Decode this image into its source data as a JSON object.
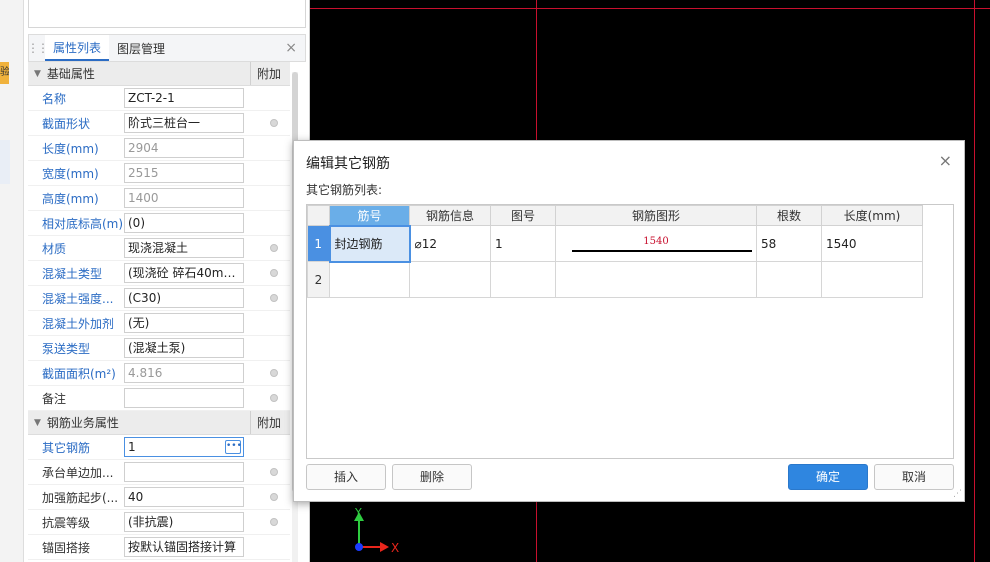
{
  "left_edge": {
    "tab_glyph": "验"
  },
  "panel": {
    "tabs": [
      {
        "label": "属性列表",
        "active": true
      },
      {
        "label": "图层管理",
        "active": false
      }
    ],
    "close_glyph": "×",
    "groups": [
      {
        "title": "基础属性",
        "extra_header": "附加",
        "rows": [
          {
            "label": "名称",
            "value": "ZCT-2-1",
            "grey": false,
            "dot": false,
            "label_blue": true
          },
          {
            "label": "截面形状",
            "value": "阶式三桩台一",
            "grey": false,
            "dot": true,
            "label_blue": true
          },
          {
            "label": "长度(mm)",
            "value": "2904",
            "grey": true,
            "dot": false,
            "label_blue": true
          },
          {
            "label": "宽度(mm)",
            "value": "2515",
            "grey": true,
            "dot": false,
            "label_blue": true
          },
          {
            "label": "高度(mm)",
            "value": "1400",
            "grey": true,
            "dot": false,
            "label_blue": true
          },
          {
            "label": "相对底标高(m)",
            "value": "(0)",
            "grey": false,
            "dot": false,
            "label_blue": true
          },
          {
            "label": "材质",
            "value": "现浇混凝土",
            "grey": false,
            "dot": true,
            "label_blue": true
          },
          {
            "label": "混凝土类型",
            "value": "(现浇砼 碎石40mm...",
            "grey": false,
            "dot": true,
            "label_blue": true
          },
          {
            "label": "混凝土强度...",
            "value": "(C30)",
            "grey": false,
            "dot": true,
            "label_blue": true
          },
          {
            "label": "混凝土外加剂",
            "value": "(无)",
            "grey": false,
            "dot": false,
            "label_blue": true
          },
          {
            "label": "泵送类型",
            "value": "(混凝土泵)",
            "grey": false,
            "dot": false,
            "label_blue": true
          },
          {
            "label": "截面面积(m²)",
            "value": "4.816",
            "grey": true,
            "dot": true,
            "label_blue": true
          },
          {
            "label": "备注",
            "value": "",
            "grey": false,
            "dot": true,
            "label_blue": false
          }
        ]
      },
      {
        "title": "钢筋业务属性",
        "extra_header": "附加",
        "rows": [
          {
            "label": "其它钢筋",
            "value": "1",
            "grey": false,
            "dot": false,
            "label_blue": true,
            "active": true
          },
          {
            "label": "承台单边加...",
            "value": "",
            "grey": false,
            "dot": true,
            "label_blue": false
          },
          {
            "label": "加强筋起步(...",
            "value": "40",
            "grey": false,
            "dot": true,
            "label_blue": false
          },
          {
            "label": "抗震等级",
            "value": "(非抗震)",
            "grey": false,
            "dot": true,
            "label_blue": false
          },
          {
            "label": "锚固搭接",
            "value": "按默认锚固搭接计算",
            "grey": false,
            "dot": false,
            "label_blue": false
          }
        ]
      }
    ]
  },
  "dialog": {
    "title": "编辑其它钢筋",
    "close_glyph": "×",
    "subtitle": "其它钢筋列表:",
    "columns": [
      "筋号",
      "钢筋信息",
      "图号",
      "钢筋图形",
      "根数",
      "长度(mm)"
    ],
    "rows": [
      {
        "num": "1",
        "bar_id": "封边钢筋",
        "info": "⌀12",
        "fig": "1",
        "shape_value": "1540",
        "count": "58",
        "length": "1540"
      },
      {
        "num": "2",
        "bar_id": "",
        "info": "",
        "fig": "",
        "shape_value": "",
        "count": "",
        "length": ""
      }
    ],
    "buttons": {
      "insert": "插入",
      "delete": "删除",
      "ok": "确定",
      "cancel": "取消"
    }
  },
  "axis": {
    "y_label": "Y",
    "x_label": "X"
  },
  "colors": {
    "accent": "#2f86e0",
    "canvas": "#000000",
    "grid_line": "#c8102e"
  }
}
